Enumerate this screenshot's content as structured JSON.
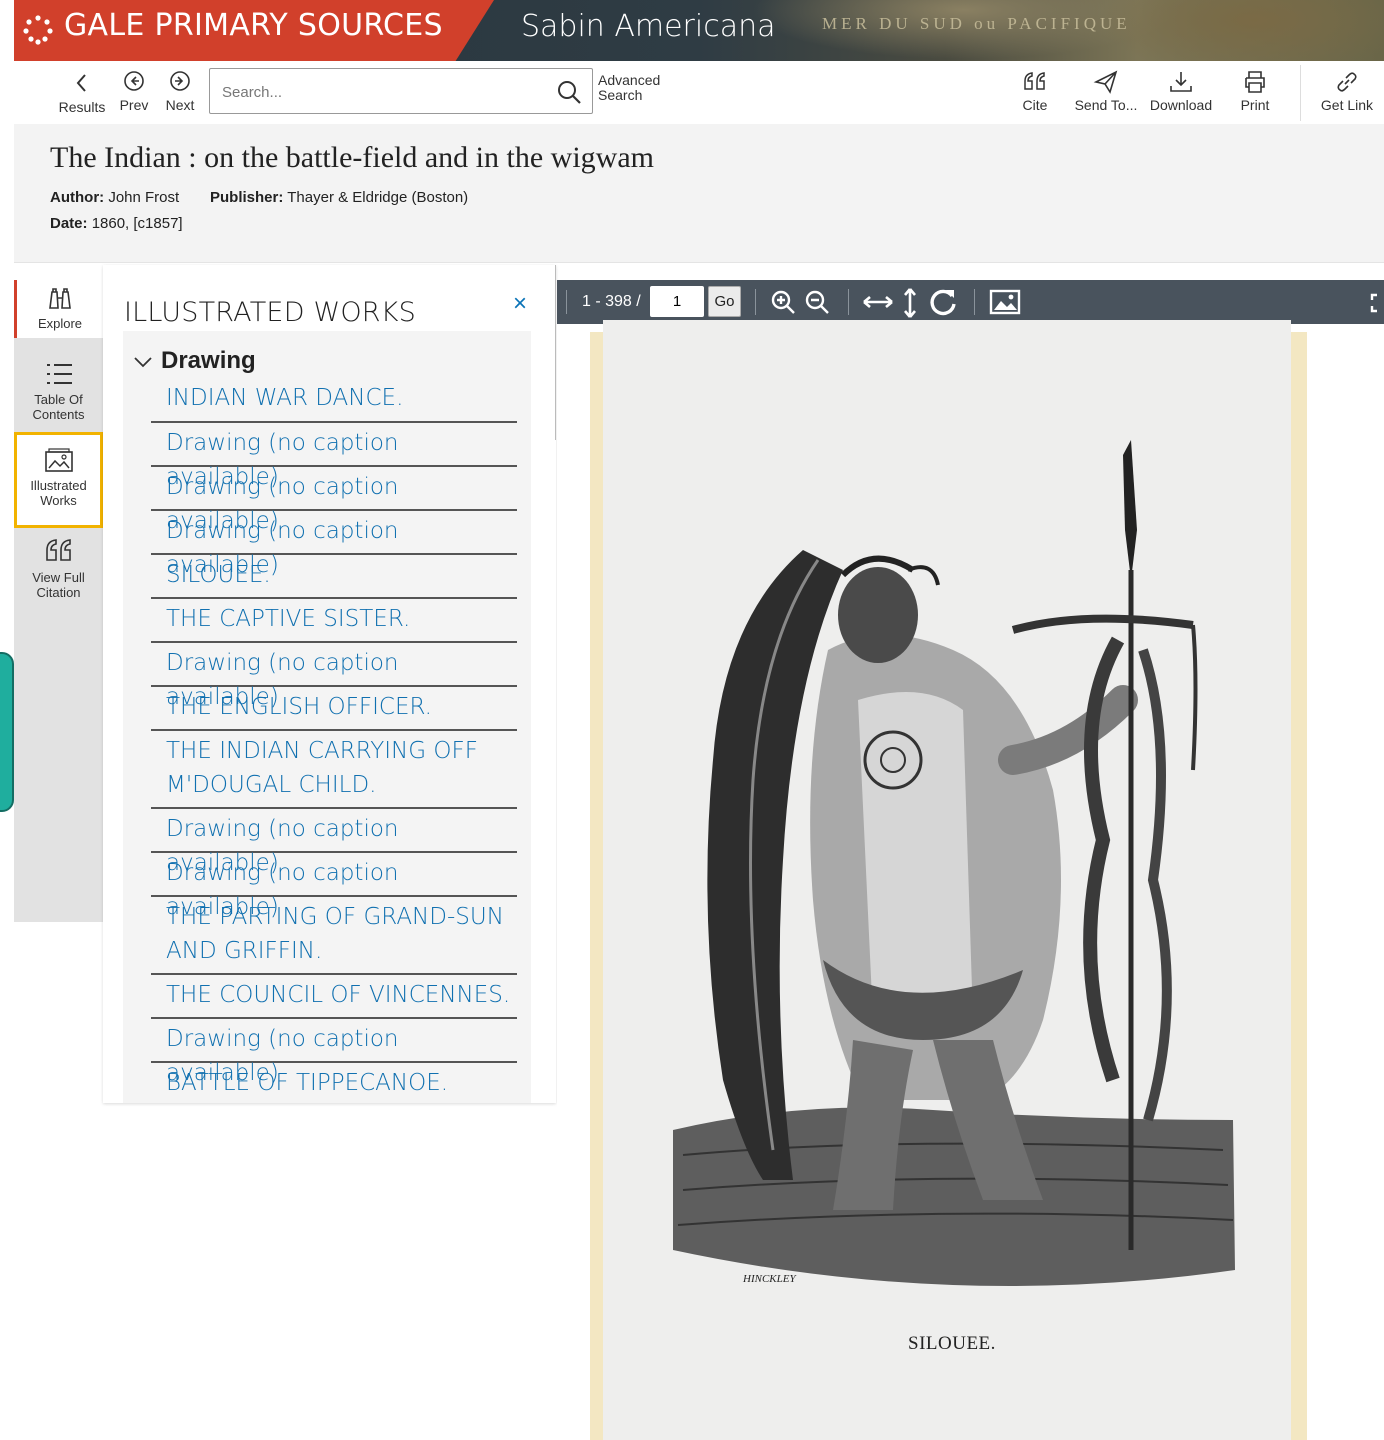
{
  "banner": {
    "brand": "GALE PRIMARY SOURCES",
    "product": "Sabin Americana",
    "map_text": "MER DU SUD ou PACIFIQUE",
    "brand_color": "#d1402b"
  },
  "toolbar": {
    "results_label": "Results",
    "prev_label": "Prev",
    "next_label": "Next",
    "search_placeholder": "Search...",
    "advanced_line1": "Advanced",
    "advanced_line2": "Search",
    "cite_label": "Cite",
    "send_label": "Send To...",
    "download_label": "Download",
    "print_label": "Print",
    "link_label": "Get Link"
  },
  "document": {
    "title": "The Indian : on the battle-field and in the wigwam",
    "author_label": "Author:",
    "author": "John Frost",
    "publisher_label": "Publisher:",
    "publisher": "Thayer & Eldridge (Boston)",
    "date_label": "Date:",
    "date": "1860, [c1857]"
  },
  "rail": {
    "explore": "Explore",
    "toc_line1": "Table Of",
    "toc_line2": "Contents",
    "illustrated_line1": "Illustrated",
    "illustrated_line2": "Works",
    "citation_line1": "View Full",
    "citation_line2": "Citation"
  },
  "panel": {
    "title": "ILLUSTRATED WORKS",
    "close": "×",
    "group": "Drawing",
    "works": [
      [
        "INDIAN WAR DANCE."
      ],
      [
        "Drawing (no caption available)"
      ],
      [
        "Drawing (no caption available)"
      ],
      [
        "Drawing (no caption available)"
      ],
      [
        "SILOUEE."
      ],
      [
        "THE CAPTIVE SISTER."
      ],
      [
        "Drawing (no caption available)"
      ],
      [
        "THE ENGLISH OFFICER."
      ],
      [
        "THE INDIAN CARRYING OFF",
        "M'DOUGAL CHILD."
      ],
      [
        "Drawing (no caption available)"
      ],
      [
        "Drawing (no caption available)"
      ],
      [
        "THE PARTING OF GRAND-SUN",
        "AND GRIFFIN."
      ],
      [
        "THE COUNCIL OF VINCENNES."
      ],
      [
        "Drawing (no caption available)"
      ],
      [
        "BATTLE OF TIPPECANOE."
      ]
    ]
  },
  "viewer": {
    "page_range": "1 - 398 /",
    "page_value": "1",
    "go_label": "Go",
    "caption": "SILOUEE.",
    "engraver": "HINCKLEY"
  }
}
